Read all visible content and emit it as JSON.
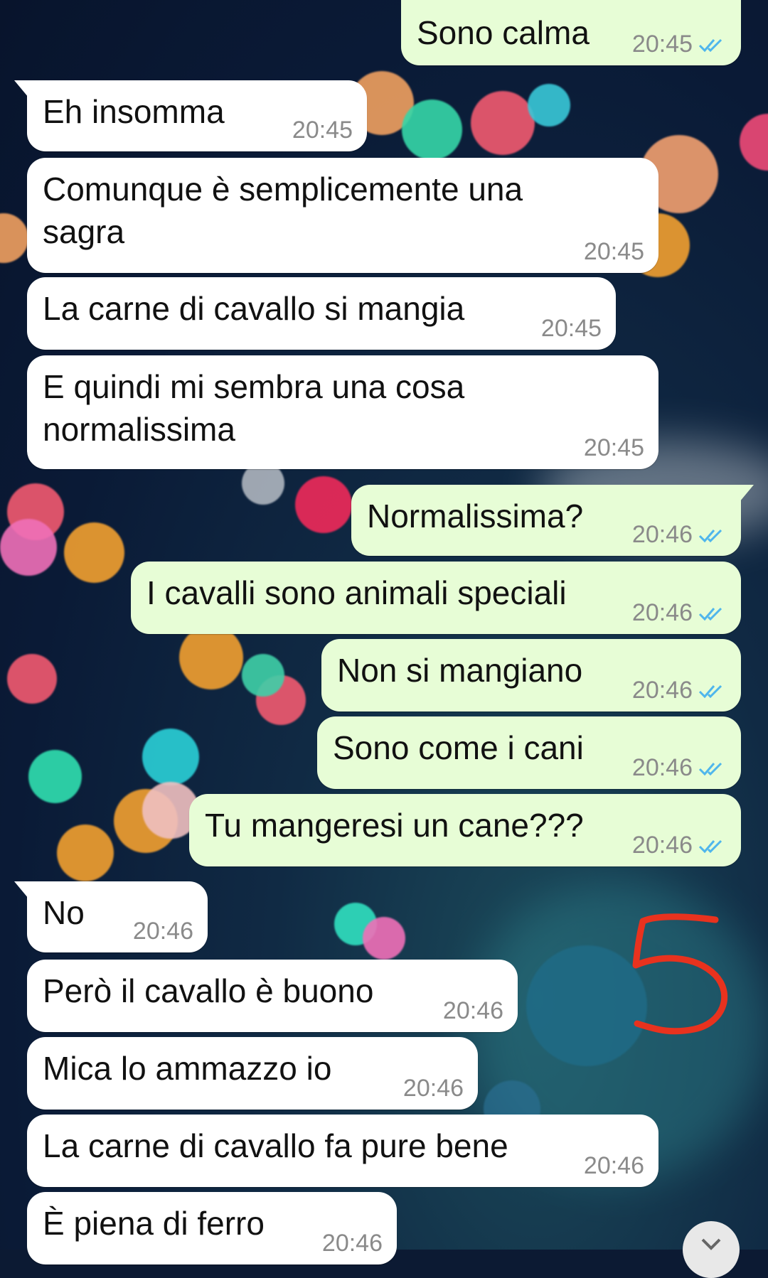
{
  "chat": {
    "messages": [
      {
        "dir": "out",
        "text": "Sono calma",
        "time": "20:45",
        "status": "read"
      },
      {
        "dir": "in",
        "text": "Eh insomma",
        "time": "20:45"
      },
      {
        "dir": "in",
        "text": "Comunque è semplicemente una sagra",
        "time": "20:45"
      },
      {
        "dir": "in",
        "text": "La carne di cavallo si mangia",
        "time": "20:45"
      },
      {
        "dir": "in",
        "text": "E quindi mi sembra una cosa normalissima",
        "time": "20:45"
      },
      {
        "dir": "out",
        "text": "Normalissima?",
        "time": "20:46",
        "status": "read"
      },
      {
        "dir": "out",
        "text": "I cavalli sono animali speciali",
        "time": "20:46",
        "status": "read"
      },
      {
        "dir": "out",
        "text": "Non si mangiano",
        "time": "20:46",
        "status": "read"
      },
      {
        "dir": "out",
        "text": "Sono come i cani",
        "time": "20:46",
        "status": "read"
      },
      {
        "dir": "out",
        "text": "Tu mangeresi un cane???",
        "time": "20:46",
        "status": "read"
      },
      {
        "dir": "in",
        "text": "No",
        "time": "20:46"
      },
      {
        "dir": "in",
        "text": "Però il cavallo è buono",
        "time": "20:46"
      },
      {
        "dir": "in",
        "text": "Mica lo ammazzo io",
        "time": "20:46"
      },
      {
        "dir": "in",
        "text": "La carne di cavallo fa pure bene",
        "time": "20:46"
      },
      {
        "dir": "in",
        "text": "È piena di ferro",
        "time": "20:46"
      }
    ]
  },
  "annotation": {
    "text": "5",
    "color": "#e8321e"
  },
  "colors": {
    "incoming": "#ffffff",
    "outgoing": "#e7fdd6",
    "read_ticks": "#4fb6ec",
    "time": "#8a8a8a"
  },
  "icons": {
    "read": "double-check-icon",
    "scroll": "chevron-down-icon"
  }
}
